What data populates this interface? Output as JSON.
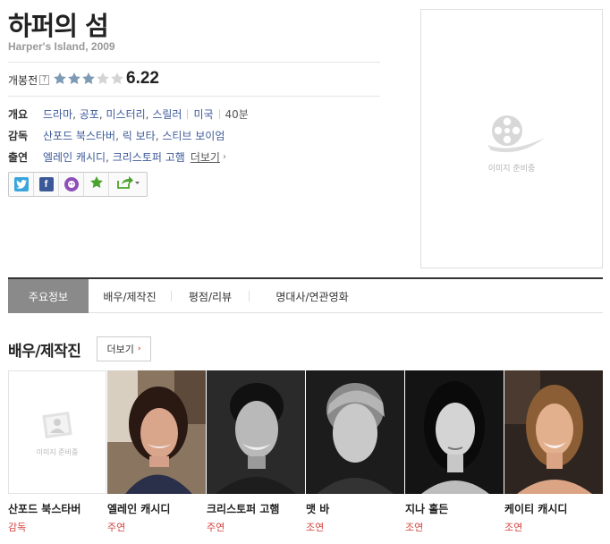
{
  "movie": {
    "title": "하퍼의 섬",
    "subtitle": "Harper's Island, 2009",
    "rating_label": "개봉전",
    "rating_help": "?",
    "rating_score": "6.22",
    "rating_stars": 3,
    "rating_max": 5
  },
  "info": {
    "overview_label": "개요",
    "genres": [
      "드라마",
      "공포",
      "미스터리",
      "스릴러"
    ],
    "country": "미국",
    "runtime": "40분",
    "director_label": "감독",
    "directors": [
      "산포드 북스타버",
      "릭 보타",
      "스티브 보이엄"
    ],
    "cast_label": "출연",
    "cast": [
      "엘레인 캐시디",
      "크리스토퍼 고햄"
    ],
    "cast_more": "더보기"
  },
  "share": {
    "buttons": [
      "twitter-icon",
      "facebook-icon",
      "me2day-icon",
      "favorite-star-icon",
      "share-icon"
    ]
  },
  "poster": {
    "placeholder_text": "이미지 준비중"
  },
  "tabs": [
    {
      "label": "주요정보",
      "active": true
    },
    {
      "label": "배우/제작진",
      "active": false
    },
    {
      "label": "평점/리뷰",
      "active": false
    },
    {
      "label": "명대사/연관영화",
      "active": false
    }
  ],
  "cast_section": {
    "title": "배우/제작진",
    "more_label": "더보기",
    "placeholder_text": "이미지 준비중",
    "members": [
      {
        "name": "산포드 북스타버",
        "role": "감독"
      },
      {
        "name": "엘레인 캐시디",
        "role": "주연"
      },
      {
        "name": "크리스토퍼 고햄",
        "role": "주연"
      },
      {
        "name": "맷 바",
        "role": "조연"
      },
      {
        "name": "지나 홀든",
        "role": "조연"
      },
      {
        "name": "케이티 캐시디",
        "role": "조연"
      }
    ]
  },
  "colors": {
    "link": "#3d5a99",
    "role": "#d4433f",
    "active_tab": "#8a8a8a",
    "star_filled": "#7f9ab5",
    "star_empty": "#d4d4d4"
  }
}
